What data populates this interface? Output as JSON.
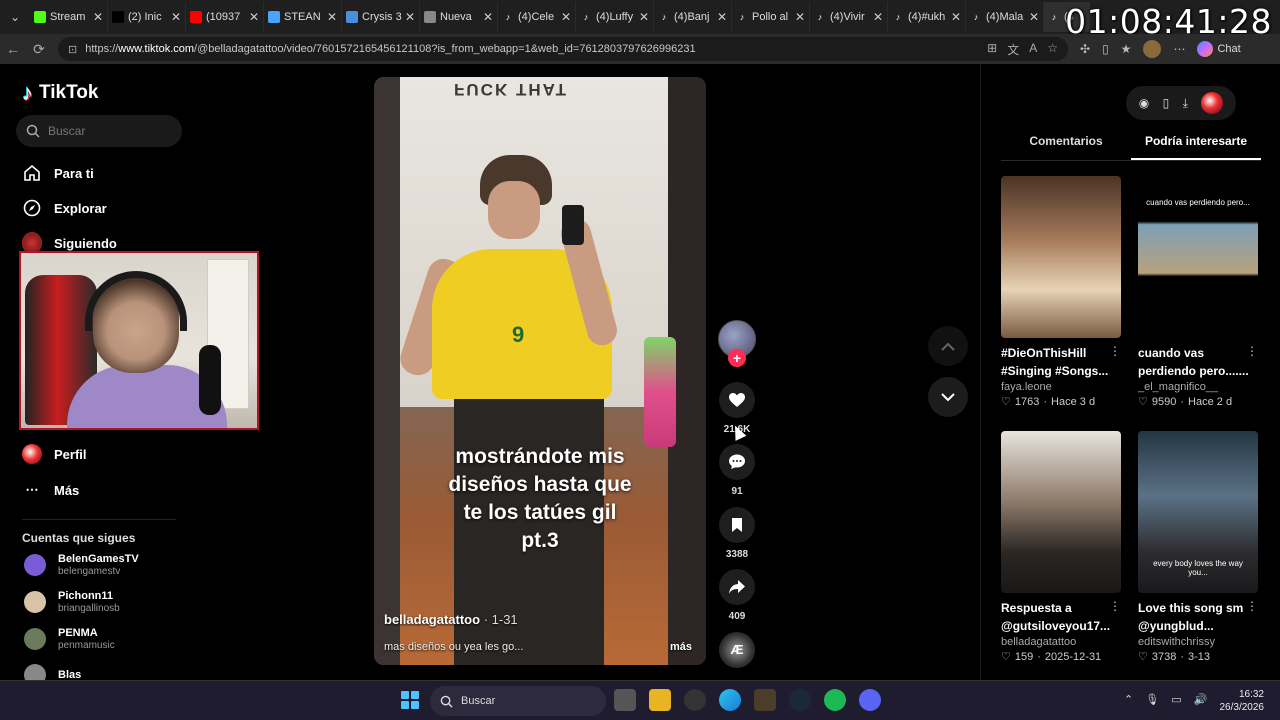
{
  "browser": {
    "tabs": [
      {
        "label": "Stream",
        "icon": "kick-icon",
        "color": "#53fc18"
      },
      {
        "label": "(2) Inic",
        "icon": "x-icon",
        "color": "#000000"
      },
      {
        "label": "(10937",
        "icon": "youtube-icon",
        "color": "#ff0000"
      },
      {
        "label": "STEAN",
        "icon": "search-icon",
        "color": "#4aa3ff"
      },
      {
        "label": "Crysis 3",
        "icon": "steam-card-icon",
        "color": "#4a90d9"
      },
      {
        "label": "Nueva",
        "icon": "newtab-icon",
        "color": "#888888"
      },
      {
        "label": "(4)Cele",
        "icon": "tiktok-icon",
        "color": "#ffffff"
      },
      {
        "label": "(4)Luffy",
        "icon": "tiktok-icon",
        "color": "#ffffff"
      },
      {
        "label": "(4)Banj",
        "icon": "tiktok-icon",
        "color": "#ffffff"
      },
      {
        "label": "Pollo al",
        "icon": "tiktok-icon",
        "color": "#ffffff"
      },
      {
        "label": "(4)Vivir",
        "icon": "tiktok-icon",
        "color": "#ffffff"
      },
      {
        "label": "(4)#ukh",
        "icon": "tiktok-icon",
        "color": "#ffffff"
      },
      {
        "label": "(4)Mala",
        "icon": "tiktok-icon",
        "color": "#ffffff"
      },
      {
        "label": "(4",
        "icon": "tiktok-icon",
        "color": "#ffffff"
      }
    ],
    "url_prefix": "https://",
    "url_host": "www.tiktok.com",
    "url_path": "/@belladagatattoo/video/7601572165456121108?is_from_webapp=1&web_id=7612803797626996231",
    "chat_label": "Chat"
  },
  "overlay_clock": "01:08:41:28",
  "tiktok": {
    "logo_text": "TikTok",
    "search_placeholder": "Buscar",
    "menu": {
      "para_ti": "Para ti",
      "explorar": "Explorar",
      "siguiendo": "Siguiendo",
      "perfil": "Perfil",
      "mas": "Más"
    },
    "following_title": "Cuentas que sigues",
    "following": [
      {
        "name": "BelenGamesTV",
        "handle": "belengamestv",
        "color": "#7b5cd6"
      },
      {
        "name": "Pichonn11",
        "handle": "briangallinosb",
        "color": "#d9c3a7"
      },
      {
        "name": "PENMA",
        "handle": "penmamusic",
        "color": "#6a7a5a"
      },
      {
        "name": "Blas",
        "handle": "",
        "color": "#888888"
      }
    ],
    "video": {
      "caption_lines": [
        "mostrándote mis",
        "diseños hasta que",
        "te los tatúes gil",
        "pt.3"
      ],
      "author": "belladagatattoo",
      "date": " · 1-31",
      "description": "mas diseños ou yea les go...",
      "more": "más",
      "wall_text": "FUCK THAT"
    },
    "actions": {
      "likes": "21.6K",
      "comments": "91",
      "saves": "3388",
      "shares": "409",
      "music_label": "Æ"
    },
    "right_panel": {
      "tabs": [
        "Comentarios",
        "Podría interesarte"
      ],
      "active_tab": 1,
      "cards": [
        {
          "title": "#DieOnThisHill #Singing #Songs...",
          "user": "faya.leone",
          "likes": "1763",
          "when": "Hace 3 d",
          "thumb_text": ""
        },
        {
          "title": "cuando vas perdiendo pero.......",
          "user": "_el_magnifico__",
          "likes": "9590",
          "when": "Hace 2 d",
          "thumb_text": "cuando vas perdiendo pero..."
        },
        {
          "title": "Respuesta a @gutsiloveyou17...",
          "user": "belladagatattoo",
          "likes": "159",
          "when": "2025-12-31",
          "thumb_text": ""
        },
        {
          "title": "Love this song sm @yungblud...",
          "user": "editswithchrissy",
          "likes": "3738",
          "when": "3-13",
          "thumb_text": "every body loves the way you..."
        }
      ]
    }
  },
  "taskbar": {
    "search_label": "Buscar",
    "time": "16:32",
    "date": "26/3/2026"
  },
  "colors": {
    "accent": "#fe2c55",
    "tiktok_cyan": "#25f4ee"
  }
}
